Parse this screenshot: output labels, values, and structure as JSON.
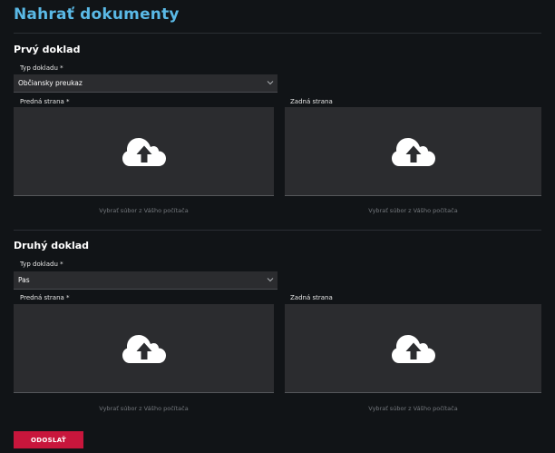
{
  "page": {
    "title": "Nahrať dokumenty"
  },
  "sections": [
    {
      "title": "Prvý doklad",
      "type_label": "Typ dokladu *",
      "type_value": "Občiansky preukaz",
      "front_label": "Predná strana *",
      "back_label": "Zadná strana",
      "front_pick": "Vybrať súbor z Vášho počítača",
      "back_pick": "Vybrať súbor z Vášho počítača"
    },
    {
      "title": "Druhý doklad",
      "type_label": "Typ dokladu *",
      "type_value": "Pas",
      "front_label": "Predná strana *",
      "back_label": "Zadná strana",
      "front_pick": "Vybrať súbor z Vášho počítača",
      "back_pick": "Vybrať súbor z Vášho počítača"
    }
  ],
  "actions": {
    "submit_label": "ODOSLAŤ"
  },
  "colors": {
    "background": "#111417",
    "title": "#5ab9e6",
    "panel": "#2b2c2f",
    "submit": "#c8163c"
  },
  "icons": {
    "upload": "cloud-upload-icon",
    "dropdown": "chevron-down-icon"
  }
}
